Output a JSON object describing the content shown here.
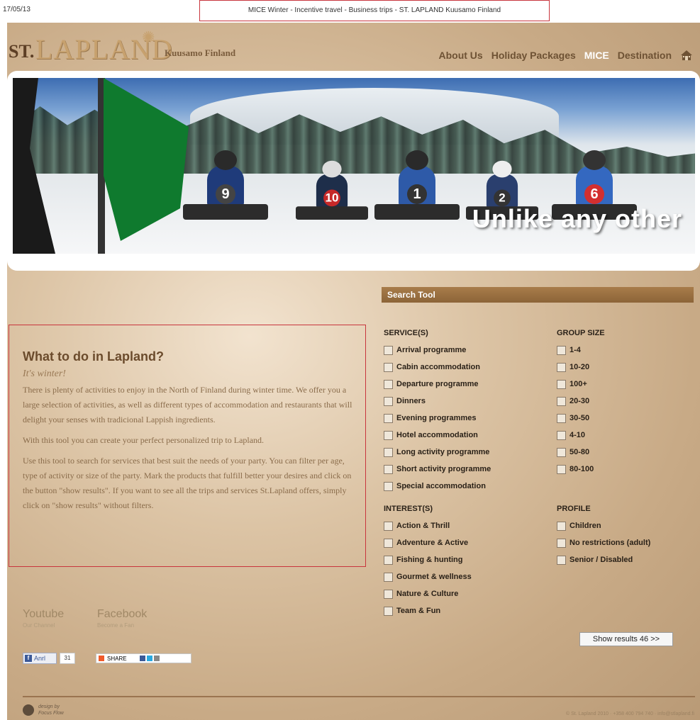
{
  "print": {
    "date": "17/05/13",
    "title": "MICE Winter - Incentive travel - Business trips - ST. LAPLAND Kuusamo Finland"
  },
  "logo": {
    "st": "ST.",
    "lapland": "LAPLAND",
    "subtitle": "Kuusamo Finland"
  },
  "nav": {
    "items": [
      {
        "label": "About Us"
      },
      {
        "label": "Holiday Packages"
      },
      {
        "label": "MICE"
      },
      {
        "label": "Destination"
      }
    ]
  },
  "banner": {
    "slogan": "Unlike any other",
    "kart_numbers": [
      "9",
      "10",
      "1",
      "2",
      "6"
    ]
  },
  "search_tool": {
    "title": "Search Tool",
    "services": {
      "title": "SERVICE(S)",
      "options": [
        "Arrival programme",
        "Cabin accommodation",
        "Departure programme",
        "Dinners",
        "Evening programmes",
        "Hotel accommodation",
        "Long activity programme",
        "Short activity programme",
        "Special accommodation"
      ]
    },
    "group_size": {
      "title": "GROUP SIZE",
      "options": [
        "1-4",
        "10-20",
        "100+",
        "20-30",
        "30-50",
        "4-10",
        "50-80",
        "80-100"
      ]
    },
    "interests": {
      "title": "INTEREST(S)",
      "options": [
        "Action & Thrill",
        "Adventure & Active",
        "Fishing & hunting",
        "Gourmet & wellness",
        "Nature & Culture",
        "Team & Fun"
      ]
    },
    "profile": {
      "title": "PROFILE",
      "options": [
        "Children",
        "No restrictions (adult)",
        "Senior / Disabled"
      ]
    },
    "show_results": "Show results 46 >>"
  },
  "intro": {
    "heading": "What to do in Lapland?",
    "subheading": "It's winter!",
    "paragraphs": [
      "There is plenty of activities to enjoy in the North of Finland during winter time. We offer you a large selection of activities, as well as different types of accommodation and restaurants that will delight your senses with tradicional Lappish ingredients.",
      "With this tool you can create your perfect personalized trip to Lapland.",
      "Use this tool to search for services that best suit the needs of your party. You can filter per age, type of activity or size of the party. Mark the products that fulfill better your desires and click on the button \"show results\". If you want to see all the trips and services St.Lapland offers, simply click on \"show results\" without filters."
    ]
  },
  "social": {
    "youtube": {
      "name": "Youtube",
      "sub": "Our Channel"
    },
    "facebook": {
      "name": "Facebook",
      "sub": "Become a Fan"
    },
    "like_label": "Anrl",
    "like_count": "31",
    "share_label": "SHARE"
  },
  "footer": {
    "design_line1": "design by",
    "design_line2": "Focus Flow",
    "right_text": "© St. Lapland 2010 · +358 400 794 740 · info@stlapland.fi"
  },
  "colors": {
    "accent": "#8c6438",
    "highlight_border": "#c8353d",
    "flag": "#0f7a2e"
  }
}
